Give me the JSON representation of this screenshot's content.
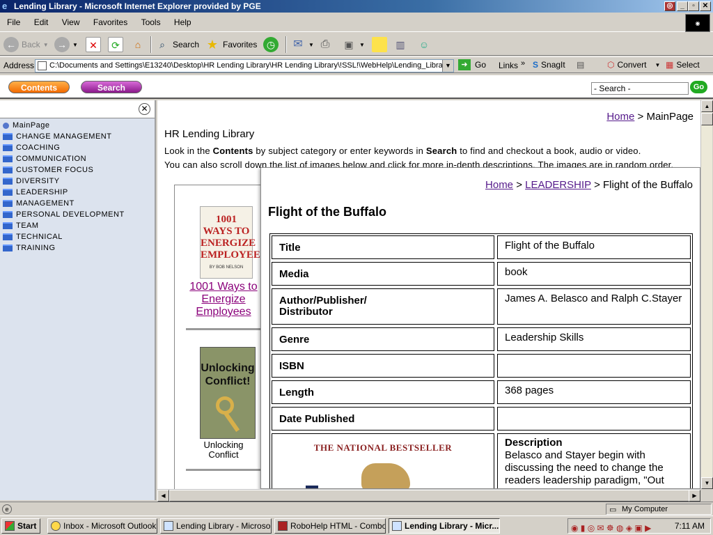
{
  "window": {
    "title": "Lending Library - Microsoft Internet Explorer provided by PGE"
  },
  "menu": [
    "File",
    "Edit",
    "View",
    "Favorites",
    "Tools",
    "Help"
  ],
  "toolbar": {
    "back": "Back",
    "search": "Search",
    "favorites": "Favorites"
  },
  "addressbar": {
    "label": "Address",
    "url": "C:\\Documents and Settings\\E13240\\Desktop\\HR Lending Library\\HR Lending Library\\!SSL!\\WebHelp\\Lending_Library.h",
    "go": "Go",
    "links": "Links",
    "snagit": "SnagIt",
    "convert": "Convert",
    "select": "Select"
  },
  "header": {
    "contents_btn": "Contents",
    "search_btn": "Search",
    "search_placeholder": "- Search -",
    "go_btn": "Go"
  },
  "sidebar": {
    "items": [
      {
        "label": "MainPage",
        "icon": "page-icon"
      },
      {
        "label": "CHANGE MANAGEMENT",
        "icon": "folder-icon"
      },
      {
        "label": "COACHING",
        "icon": "folder-icon"
      },
      {
        "label": "COMMUNICATION",
        "icon": "folder-icon"
      },
      {
        "label": "CUSTOMER FOCUS",
        "icon": "folder-icon"
      },
      {
        "label": "DIVERSITY",
        "icon": "folder-icon"
      },
      {
        "label": "LEADERSHIP",
        "icon": "folder-icon"
      },
      {
        "label": "MANAGEMENT",
        "icon": "folder-icon"
      },
      {
        "label": "PERSONAL DEVELOPMENT",
        "icon": "folder-icon"
      },
      {
        "label": "TEAM",
        "icon": "folder-icon"
      },
      {
        "label": "TECHNICAL",
        "icon": "folder-icon"
      },
      {
        "label": "TRAINING",
        "icon": "folder-icon"
      }
    ]
  },
  "main": {
    "breadcrumb": {
      "home": "Home",
      "sep": ">",
      "current": "MainPage"
    },
    "title": "HR Lending Library",
    "intro1_a": "Look in the ",
    "intro1_b": "Contents",
    "intro1_c": " by subject category or enter keywords in ",
    "intro1_d": "Search",
    "intro1_e": " to find and checkout a book, audio or video.",
    "intro2": "You can also scroll down the list of images below and click for more in-depth descriptions. The images are in random order.",
    "book1": {
      "cover": "1001 WAYS TO ENERGIZE EMPLOYEES",
      "author": "BY BOB NELSON",
      "link": "1001 Ways to Energize Employees"
    },
    "book2": {
      "cover": "Unlocking Conflict!",
      "caption": "Unlocking Conflict"
    }
  },
  "popup": {
    "breadcrumb": {
      "home": "Home",
      "sep1": ">",
      "category": "LEADERSHIP",
      "sep2": ">",
      "current": "Flight of the Buffalo"
    },
    "title": "Flight of the Buffalo",
    "rows": [
      {
        "label": "Title",
        "value": "Flight of the Buffalo"
      },
      {
        "label": "Media",
        "value": "book"
      },
      {
        "label": "Author/Publisher/ Distributor",
        "value": "James A. Belasco and Ralph C.Stayer"
      },
      {
        "label": "Genre",
        "value": "Leadership Skills"
      },
      {
        "label": "ISBN",
        "value": ""
      },
      {
        "label": "Length",
        "value": "368 pages"
      },
      {
        "label": "Date Published",
        "value": ""
      }
    ],
    "cover_text": "THE NATIONAL BESTSELLER",
    "desc_label": "Description",
    "desc_text": "Belasco and Stayer begin with discussing the need to change the readers leadership paradigm, \"Out"
  },
  "status": {
    "zone": "My Computer"
  },
  "taskbar": {
    "start": "Start",
    "items": [
      "Inbox - Microsoft Outlook",
      "Lending Library - Microso...",
      "RoboHelp HTML - Combo...",
      "Lending Library - Micr..."
    ],
    "time": "7:11 AM"
  }
}
